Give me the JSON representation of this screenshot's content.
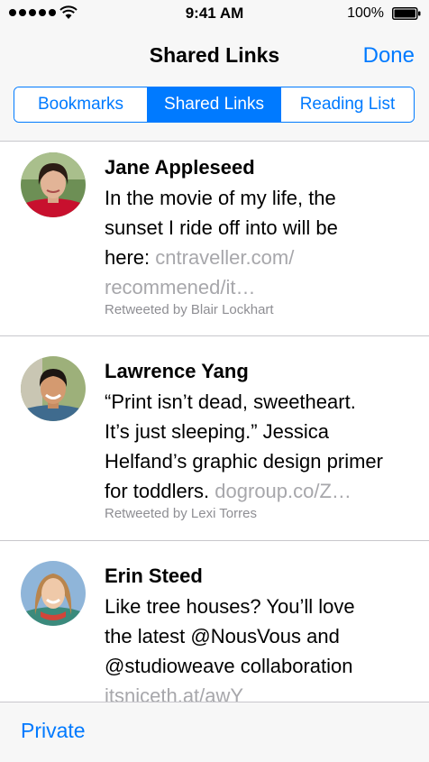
{
  "status_bar": {
    "time": "9:41 AM",
    "battery": "100%"
  },
  "nav": {
    "title": "Shared Links",
    "done_label": "Done"
  },
  "segments": [
    {
      "label": "Bookmarks",
      "active": false
    },
    {
      "label": "Shared Links",
      "active": true
    },
    {
      "label": "Reading List",
      "active": false
    }
  ],
  "items": [
    {
      "name": "Jane Appleseed",
      "text_lines": [
        "In the movie of my life, the",
        "sunset I ride off into will be",
        "here: "
      ],
      "link_lines": [
        "cntraveller.com/",
        "recommened/it…"
      ],
      "retweeted_by": "Retweeted by Blair Lockhart"
    },
    {
      "name": "Lawrence Yang",
      "text_lines": [
        "“Print isn’t dead, sweetheart.",
        "It’s just sleeping.” Jessica",
        "Helfand’s graphic design primer",
        "for toddlers. "
      ],
      "link_lines": [
        "dogroup.co/Z…"
      ],
      "retweeted_by": "Retweeted by Lexi Torres"
    },
    {
      "name": "Erin Steed",
      "text_lines": [
        "Like tree houses? You’ll love",
        "the latest @NousVous and",
        "@studioweave collaboration"
      ],
      "link_lines": [
        "itsniceth.at/awY"
      ]
    }
  ],
  "toolbar": {
    "private_label": "Private"
  }
}
